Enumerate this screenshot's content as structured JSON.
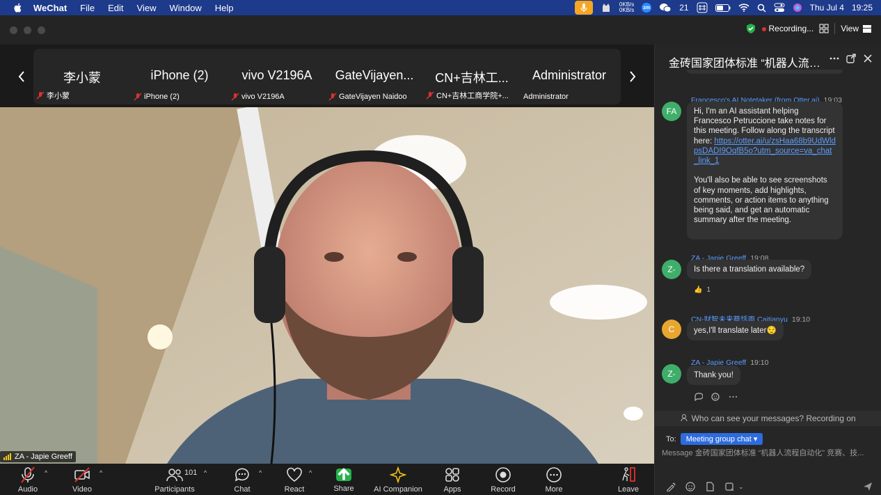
{
  "menubar": {
    "app": "WeChat",
    "items": [
      "File",
      "Edit",
      "View",
      "Window",
      "Help"
    ],
    "net_up": "0KB/s",
    "net_down": "0KB/s",
    "zoom_badge": "zm",
    "wechat_count": "21",
    "date": "Thu Jul 4",
    "time": "19:25"
  },
  "titlebar": {
    "recording_label": "Recording...",
    "view_label": "View"
  },
  "strip": {
    "participants": [
      {
        "big": "李小蒙",
        "small": "李小蒙"
      },
      {
        "big": "iPhone (2)",
        "small": "iPhone (2)"
      },
      {
        "big": "vivo V2196A",
        "small": "vivo V2196A"
      },
      {
        "big": "GateVijayen...",
        "small": "GateVijayen Naidoo"
      },
      {
        "big": "CN+吉林工...",
        "small": "CN+吉林工商学院+..."
      },
      {
        "big": "Administrator",
        "small": "Administrator"
      }
    ]
  },
  "main": {
    "speaker_name": "ZA - Japie Greeff"
  },
  "toolbar": {
    "audio": "Audio",
    "video": "Video",
    "participants": "Participants",
    "participants_count": "101",
    "chat": "Chat",
    "react": "React",
    "share": "Share",
    "ai_companion": "AI Companion",
    "apps": "Apps",
    "record": "Record",
    "more": "More",
    "leave": "Leave"
  },
  "chat": {
    "title": "金砖国家团体标准 “机器人流程自动化” 竞...",
    "messages": [
      {
        "avatar": "FA",
        "avatar_color": "#3fae6a",
        "sender": "Francesco's AI Notetaker (from Otter.ai)",
        "time": "19:03",
        "text1": "Hi, I'm an AI assistant helping Francesco Petruccione take notes for this meeting. Follow along the transcript here:",
        "link": "https://otter.ai/u/zsHaa68b9UdWldpsDADI9OqfB5o?utm_source=va_chat_link_1",
        "text2": "You'll also be able to see screenshots of key moments, add highlights, comments, or action items to anything being said, and get an automatic summary after the meeting."
      },
      {
        "avatar": "Z-",
        "avatar_color": "#3fae6a",
        "sender": "ZA - Japie Greeff",
        "time": "19:08",
        "text": "Is there a translation available?",
        "reaction_count": "1"
      },
      {
        "avatar": "C",
        "avatar_color": "#e8a630",
        "sender": "CN-财智未来蔡恬雨 Caitianyu",
        "time": "19:10",
        "text": "yes,I'll translate later😌"
      },
      {
        "avatar": "Z-",
        "avatar_color": "#3fae6a",
        "sender": "ZA - Japie Greeff",
        "time": "19:10",
        "text": "Thank you!"
      }
    ],
    "who_sees": "Who can see your messages? Recording on",
    "to_label": "To:",
    "to_target": "Meeting group chat",
    "input_placeholder": "Message 金砖国家团体标准 “机器人流程自动化” 竞赛、技..."
  }
}
